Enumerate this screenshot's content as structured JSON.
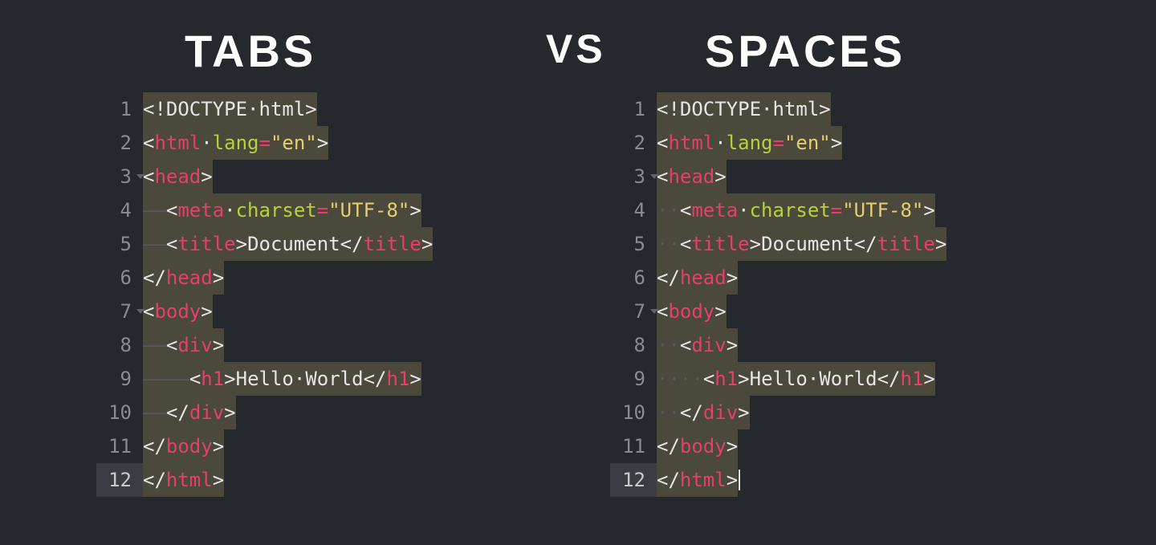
{
  "heading": {
    "left": "TABS",
    "mid": "VS",
    "right": "SPACES"
  },
  "indent_glyphs": {
    "tab": "——",
    "space": "··"
  },
  "lines": [
    {
      "num": "1",
      "fold": false,
      "indent": 0,
      "tokens": [
        [
          "p",
          "<"
        ],
        [
          "txt",
          "!DOCTYPE"
        ],
        [
          "p",
          "·"
        ],
        [
          "txt",
          "html"
        ],
        [
          "p",
          ">"
        ]
      ]
    },
    {
      "num": "2",
      "fold": false,
      "indent": 0,
      "tokens": [
        [
          "p",
          "<"
        ],
        [
          "tag",
          "html"
        ],
        [
          "p",
          "·"
        ],
        [
          "at",
          "lang"
        ],
        [
          "op",
          "="
        ],
        [
          "str",
          "\"en\""
        ],
        [
          "p",
          ">"
        ]
      ]
    },
    {
      "num": "3",
      "fold": true,
      "indent": 0,
      "tokens": [
        [
          "p",
          "<"
        ],
        [
          "tag",
          "head"
        ],
        [
          "p",
          ">"
        ]
      ]
    },
    {
      "num": "4",
      "fold": false,
      "indent": 1,
      "tokens": [
        [
          "p",
          "<"
        ],
        [
          "tag",
          "meta"
        ],
        [
          "p",
          "·"
        ],
        [
          "at",
          "charset"
        ],
        [
          "op",
          "="
        ],
        [
          "str",
          "\"UTF-8\""
        ],
        [
          "p",
          ">"
        ]
      ]
    },
    {
      "num": "5",
      "fold": false,
      "indent": 1,
      "tokens": [
        [
          "p",
          "<"
        ],
        [
          "tag",
          "title"
        ],
        [
          "p",
          ">"
        ],
        [
          "txt",
          "Document"
        ],
        [
          "p",
          "</"
        ],
        [
          "tag",
          "title"
        ],
        [
          "p",
          ">"
        ]
      ]
    },
    {
      "num": "6",
      "fold": false,
      "indent": 0,
      "tokens": [
        [
          "p",
          "</"
        ],
        [
          "tag",
          "head"
        ],
        [
          "p",
          ">"
        ]
      ]
    },
    {
      "num": "7",
      "fold": true,
      "indent": 0,
      "tokens": [
        [
          "p",
          "<"
        ],
        [
          "tag",
          "body"
        ],
        [
          "p",
          ">"
        ]
      ]
    },
    {
      "num": "8",
      "fold": false,
      "indent": 1,
      "tokens": [
        [
          "p",
          "<"
        ],
        [
          "tag",
          "div"
        ],
        [
          "p",
          ">"
        ]
      ]
    },
    {
      "num": "9",
      "fold": false,
      "indent": 2,
      "tokens": [
        [
          "p",
          "<"
        ],
        [
          "tag",
          "h1"
        ],
        [
          "p",
          ">"
        ],
        [
          "txt",
          "Hello·World"
        ],
        [
          "p",
          "</"
        ],
        [
          "tag",
          "h1"
        ],
        [
          "p",
          ">"
        ]
      ]
    },
    {
      "num": "10",
      "fold": false,
      "indent": 1,
      "tokens": [
        [
          "p",
          "</"
        ],
        [
          "tag",
          "div"
        ],
        [
          "p",
          ">"
        ]
      ]
    },
    {
      "num": "11",
      "fold": false,
      "indent": 0,
      "tokens": [
        [
          "p",
          "</"
        ],
        [
          "tag",
          "body"
        ],
        [
          "p",
          ">"
        ]
      ]
    },
    {
      "num": "12",
      "fold": false,
      "indent": 0,
      "tokens": [
        [
          "p",
          "</"
        ],
        [
          "tag",
          "html"
        ],
        [
          "p",
          ">"
        ]
      ]
    }
  ],
  "left": {
    "current_line": 12,
    "show_cursor": false
  },
  "right": {
    "current_line": 12,
    "show_cursor": true
  }
}
